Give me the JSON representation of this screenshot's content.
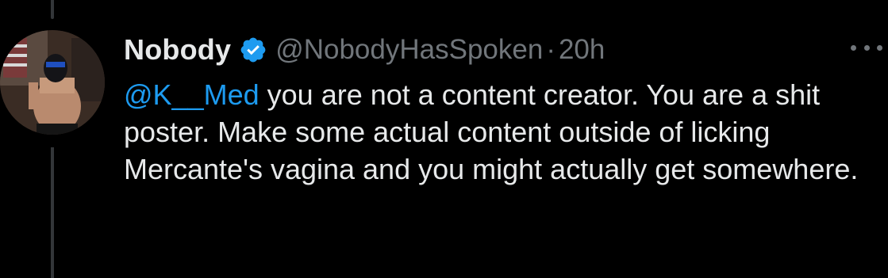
{
  "tweet": {
    "display_name": "Nobody",
    "handle": "@NobodyHasSpoken",
    "separator": "·",
    "timestamp": "20h",
    "verified": true,
    "mention": "@K__Med",
    "body": " you are not a content creator. You are a shit poster. Make some actual content outside of licking Mercante's vagina and you might actually get somewhere."
  },
  "colors": {
    "background": "#000000",
    "text_primary": "#e7e9ea",
    "text_secondary": "#71767b",
    "accent": "#1d9bf0",
    "thread_line": "#333639"
  },
  "icons": {
    "verified": "verified-badge-icon",
    "more": "more-options-icon"
  }
}
